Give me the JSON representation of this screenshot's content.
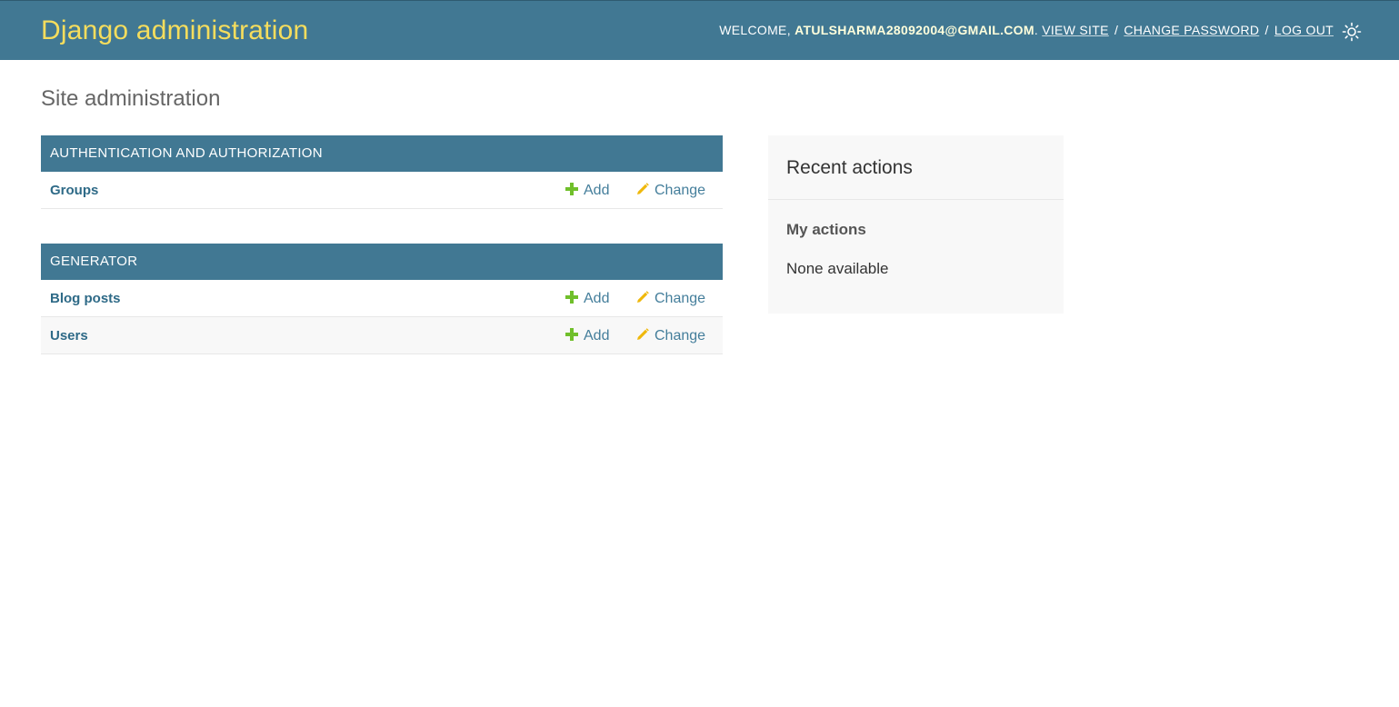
{
  "header": {
    "brand": "Django administration",
    "welcome": "WELCOME,",
    "username": "ATULSHARMA28092004@GMAIL.COM",
    "username_suffix": ".",
    "view_site": "VIEW SITE",
    "change_password": "CHANGE PASSWORD",
    "log_out": "LOG OUT",
    "separator": "/",
    "theme_icon": "sun-icon"
  },
  "page": {
    "title": "Site administration"
  },
  "modules": [
    {
      "caption": "AUTHENTICATION AND AUTHORIZATION",
      "models": [
        {
          "name": "Groups",
          "add": "Add",
          "change": "Change"
        }
      ]
    },
    {
      "caption": "GENERATOR",
      "models": [
        {
          "name": "Blog posts",
          "add": "Add",
          "change": "Change"
        },
        {
          "name": "Users",
          "add": "Add",
          "change": "Change"
        }
      ]
    }
  ],
  "recent_actions": {
    "title": "Recent actions",
    "my_actions": "My actions",
    "empty": "None available"
  },
  "colors": {
    "header_bg": "#417893",
    "brand": "#f5dd5d",
    "link": "#447e9b",
    "add_icon": "#70bf2b",
    "change_icon": "#efb80b"
  }
}
